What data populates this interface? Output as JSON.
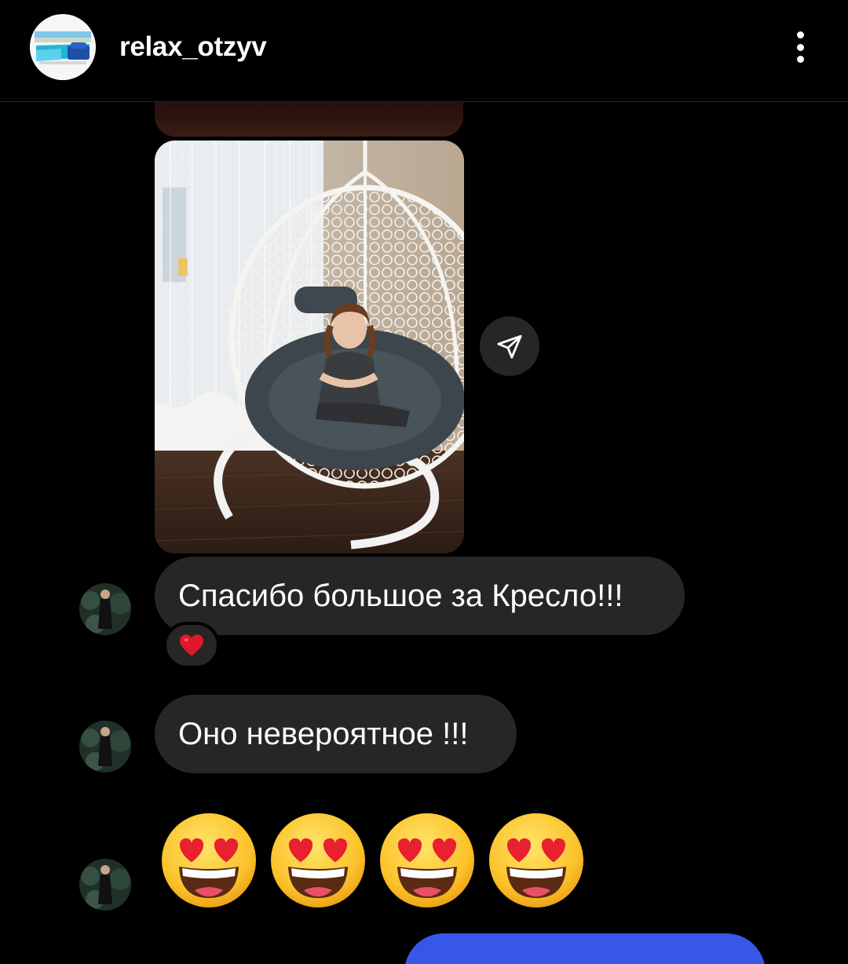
{
  "header": {
    "username": "relax_otzyv",
    "avatar_logo_text": "RELAX GOROD",
    "avatar_sub_text": "relax_gorod"
  },
  "icons": {
    "more": "more-vertical-icon",
    "share": "send-icon",
    "reaction": "red-heart"
  },
  "messages": [
    {
      "type": "image",
      "from": "other"
    },
    {
      "type": "text",
      "from": "other",
      "text": "Спасибо большое за Кресло!!!",
      "reaction": "❤"
    },
    {
      "type": "text",
      "from": "other",
      "text": "Оно невероятное !!!"
    },
    {
      "type": "emoji",
      "from": "other",
      "emojis": [
        "😍",
        "😍",
        "😍",
        "😍"
      ]
    },
    {
      "type": "text",
      "from": "me",
      "text": ""
    }
  ],
  "colors": {
    "background": "#000000",
    "incoming_bubble": "#262626",
    "outgoing_bubble": "#3757e8",
    "text": "#ffffff"
  }
}
